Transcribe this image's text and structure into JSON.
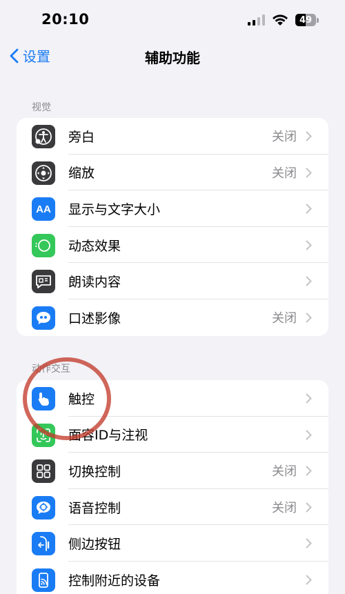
{
  "status_bar": {
    "time": "20:10",
    "battery": "49"
  },
  "nav": {
    "back_label": "设置",
    "title": "辅助功能"
  },
  "sections": [
    {
      "header": "视觉",
      "items": [
        {
          "label": "旁白",
          "value": "关闭",
          "icon": "voiceover-icon",
          "color": "#3a3a3c"
        },
        {
          "label": "缩放",
          "value": "关闭",
          "icon": "zoom-icon",
          "color": "#3a3a3c"
        },
        {
          "label": "显示与文字大小",
          "value": "",
          "icon": "text-size-icon",
          "color": "#1a7cf5"
        },
        {
          "label": "动态效果",
          "value": "",
          "icon": "motion-icon",
          "color": "#34c759"
        },
        {
          "label": "朗读内容",
          "value": "",
          "icon": "spoken-content-icon",
          "color": "#3a3a3c"
        },
        {
          "label": "口述影像",
          "value": "关闭",
          "icon": "audio-description-icon",
          "color": "#1a7cf5"
        }
      ]
    },
    {
      "header": "动作交互",
      "items": [
        {
          "label": "触控",
          "value": "",
          "icon": "touch-icon",
          "color": "#1a7cf5"
        },
        {
          "label": "面容ID与注视",
          "value": "",
          "icon": "face-id-icon",
          "color": "#34c759"
        },
        {
          "label": "切换控制",
          "value": "关闭",
          "icon": "switch-control-icon",
          "color": "#3a3a3c"
        },
        {
          "label": "语音控制",
          "value": "关闭",
          "icon": "voice-control-icon",
          "color": "#1a7cf5"
        },
        {
          "label": "侧边按钮",
          "value": "",
          "icon": "side-button-icon",
          "color": "#1a7cf5"
        },
        {
          "label": "控制附近的设备",
          "value": "",
          "icon": "nearby-devices-icon",
          "color": "#1a7cf5"
        }
      ]
    }
  ],
  "colors": {
    "accent": "#1a7cf5",
    "annotation_circle": "#c33c2d"
  }
}
